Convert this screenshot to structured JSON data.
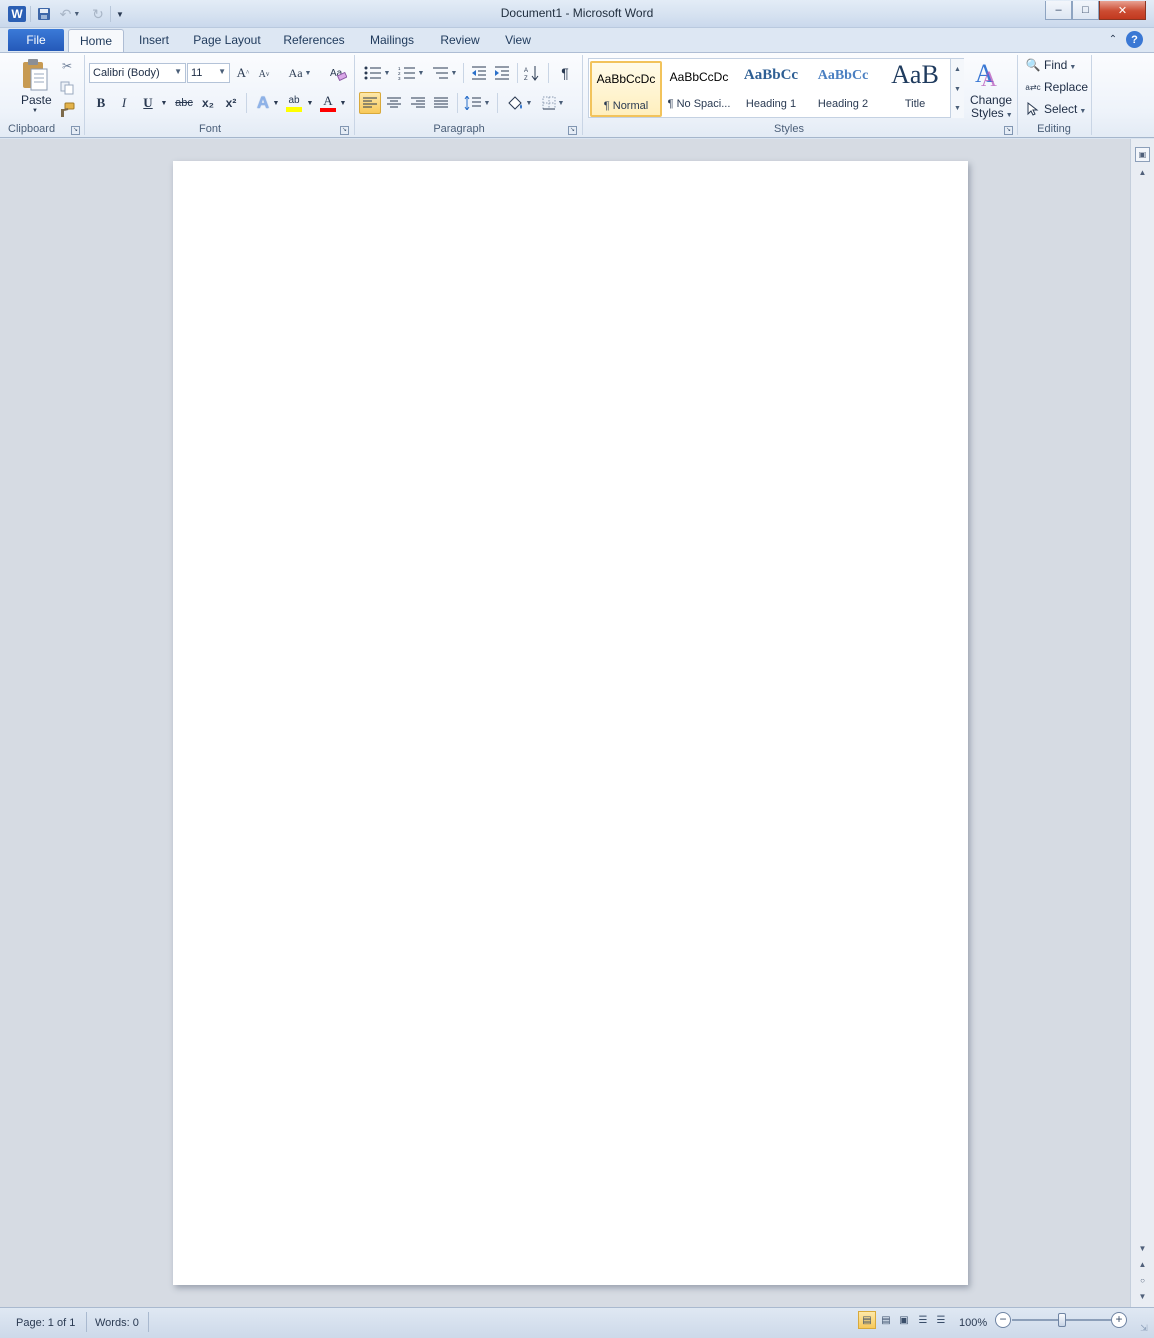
{
  "window": {
    "title": "Document1  -  Microsoft Word",
    "minimize": "–",
    "restore": "□",
    "close": "✕"
  },
  "qat": {
    "app_icon": "W",
    "save_icon": "save-icon",
    "undo_icon": "undo-icon",
    "redo_icon": "redo-icon",
    "customize_icon": "customize-qat-icon"
  },
  "tabs": {
    "file": "File",
    "items": [
      {
        "label": "Home"
      },
      {
        "label": "Insert"
      },
      {
        "label": "Page Layout"
      },
      {
        "label": "References"
      },
      {
        "label": "Mailings"
      },
      {
        "label": "Review"
      },
      {
        "label": "View"
      }
    ]
  },
  "clipboard": {
    "paste": "Paste",
    "group": "Clipboard"
  },
  "font": {
    "family": "Calibri (Body)",
    "size": "11",
    "grow": "A",
    "shrink": "A",
    "change_case": "Aa",
    "bold": "B",
    "italic": "I",
    "underline": "U",
    "strike": "abc",
    "subscript": "x₂",
    "superscript": "x²",
    "text_effects": "A",
    "highlight": "ab",
    "font_color": "A",
    "group": "Font",
    "highlight_color": "#ffff00",
    "font_color_bar": "#ff0000"
  },
  "paragraph": {
    "show_hide": "¶",
    "group": "Paragraph"
  },
  "styles": {
    "items": [
      {
        "preview": "AaBbCcDc",
        "name": "¶ Normal"
      },
      {
        "preview": "AaBbCcDc",
        "name": "¶ No Spaci..."
      },
      {
        "preview": "AaBbCc",
        "name": "Heading 1"
      },
      {
        "preview": "AaBbCc",
        "name": "Heading 2"
      },
      {
        "preview": "AaB",
        "name": "Title"
      }
    ],
    "change_styles_line1": "Change",
    "change_styles_line2": "Styles",
    "group": "Styles"
  },
  "editing": {
    "find": "Find",
    "replace": "Replace",
    "select": "Select",
    "group": "Editing"
  },
  "status": {
    "page": "Page: 1 of 1",
    "words": "Words: 0",
    "zoom": "100%",
    "zoom_level": 1.0
  },
  "colors": {
    "accent": "#2559b8",
    "page": "#ffffff",
    "doc_background": "#d6dbe3"
  }
}
